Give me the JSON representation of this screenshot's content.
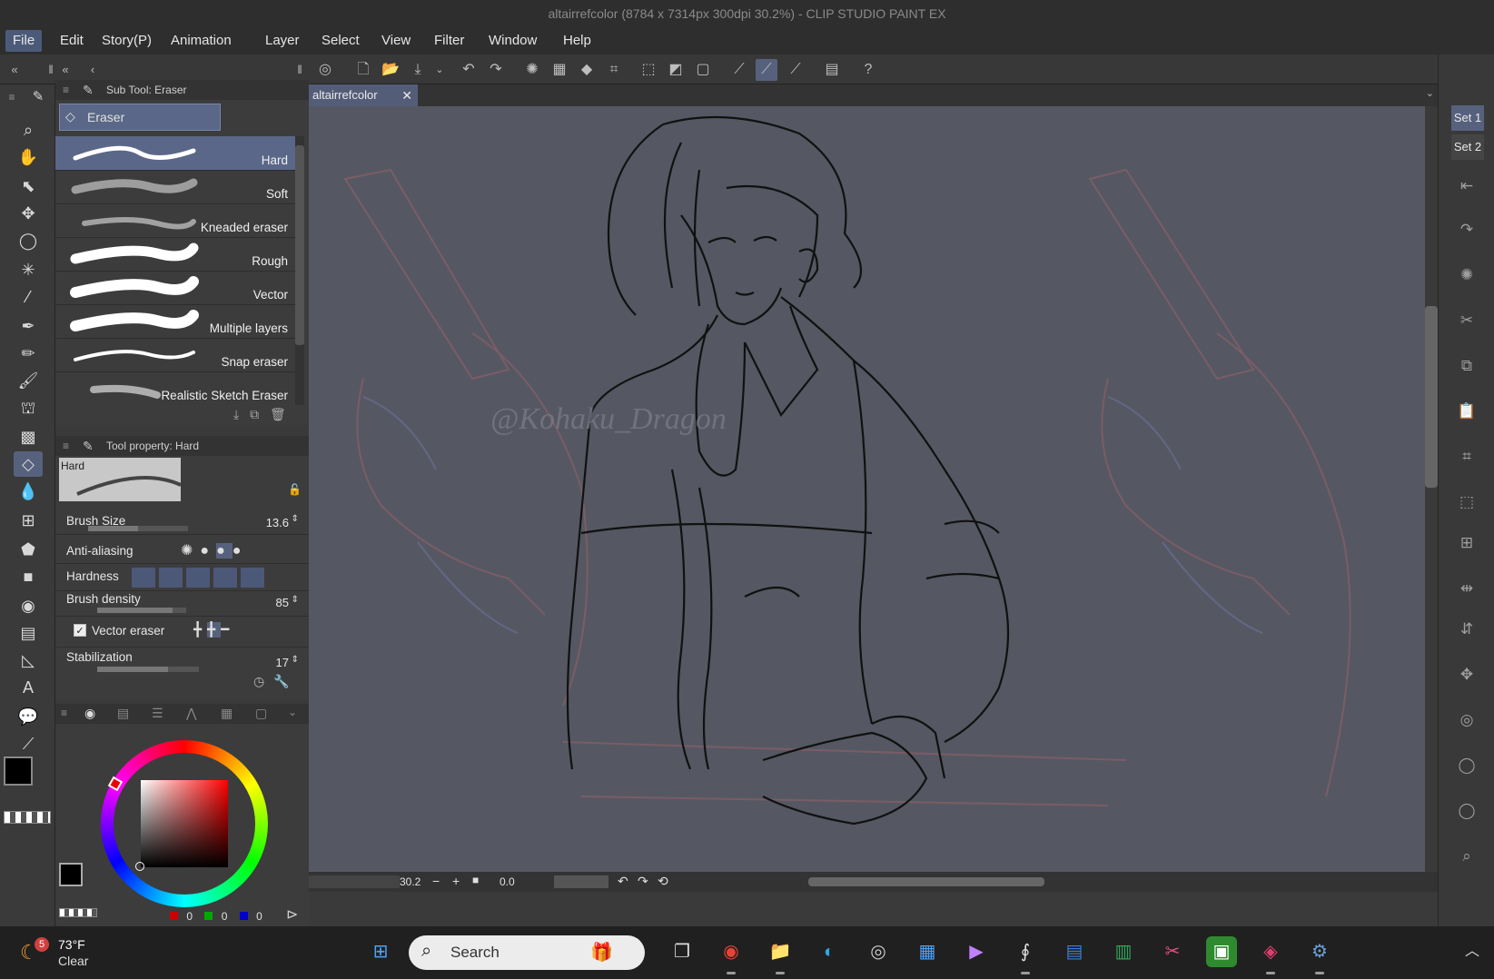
{
  "window": {
    "title": "altairrefcolor (8784 x 7314px 300dpi 30.2%)  - CLIP STUDIO PAINT EX"
  },
  "menu": [
    "File",
    "Edit",
    "Story(P)",
    "Animation",
    "Layer",
    "Select",
    "View",
    "Filter",
    "Window",
    "Help"
  ],
  "subtool_panel": {
    "header": "Sub Tool: Eraser",
    "group_tab": "Eraser",
    "brushes": [
      {
        "label": "Hard"
      },
      {
        "label": "Soft"
      },
      {
        "label": "Kneaded eraser"
      },
      {
        "label": "Rough"
      },
      {
        "label": "Vector"
      },
      {
        "label": "Multiple layers"
      },
      {
        "label": "Snap eraser"
      },
      {
        "label": "Realistic Sketch Eraser"
      }
    ]
  },
  "tool_property": {
    "header": "Tool property: Hard",
    "preview_label": "Hard",
    "brush_size_label": "Brush Size",
    "brush_size_value": "13.6",
    "brush_size_fill": 0.5,
    "anti_aliasing_label": "Anti-aliasing",
    "hardness_label": "Hardness",
    "brush_density_label": "Brush density",
    "brush_density_value": "85",
    "brush_density_fill": 0.85,
    "vector_eraser_label": "Vector eraser",
    "vector_eraser_checked": true,
    "stabilization_label": "Stabilization",
    "stabilization_value": "17",
    "stabilization_fill": 0.7
  },
  "color": {
    "main": "#000000",
    "sub": "#3a3a3a",
    "rgb": {
      "r": "0",
      "g": "0",
      "b": "0"
    }
  },
  "document": {
    "tab_name": "altairrefcolor",
    "watermark": "@Kohaku_Dragon"
  },
  "status": {
    "zoom": "30.2",
    "rotation": "0.0"
  },
  "right_dock": {
    "sets": [
      "Set 1",
      "Set 2"
    ]
  },
  "taskbar": {
    "weather_temp": "73°F",
    "weather_desc": "Clear",
    "weather_badge": "5",
    "search_placeholder": "Search"
  }
}
